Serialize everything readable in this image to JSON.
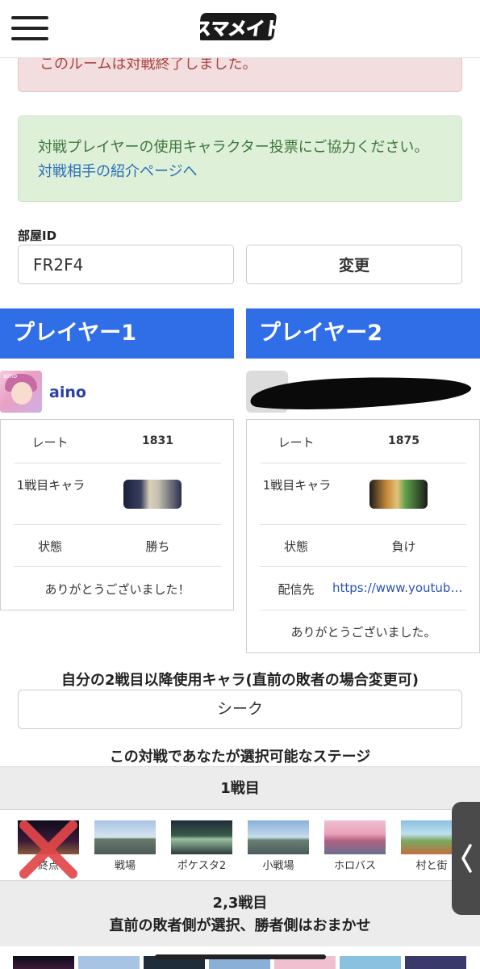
{
  "header": {
    "logo_text": "スマメイト"
  },
  "alert_closed": "このルームは対戦終了しました。",
  "vote_alert": {
    "text": "対戦プレイヤーの使用キャラクター投票にご協力ください。",
    "link": "対戦相手の紹介ページへ"
  },
  "room": {
    "label": "部屋ID",
    "value": "FR2F4",
    "change_label": "変更"
  },
  "player1": {
    "heading": "プレイヤー1",
    "name": "aino",
    "avatar_text": "aino",
    "rate_label": "レート",
    "rate": "1831",
    "char_label": "1戦目キャラ",
    "status_label": "状態",
    "status": "勝ち",
    "message": "ありがとうございました！"
  },
  "player2": {
    "heading": "プレイヤー2",
    "rate_label": "レート",
    "rate": "1875",
    "char_label": "1戦目キャラ",
    "status_label": "状態",
    "status": "負け",
    "stream_label": "配信先",
    "stream_url": "https://www.youtube…",
    "message": "ありがとうございました。"
  },
  "char_section": {
    "title": "自分の2戦目以降使用キャラ(直前の敗者の場合変更可)",
    "selected": "シーク"
  },
  "stage_section": {
    "title": "この対戦であなたが選択可能なステージ",
    "round1_label": "1戦目",
    "stages": [
      {
        "name": "終点",
        "disabled": true
      },
      {
        "name": "戦場",
        "disabled": false
      },
      {
        "name": "ポケスタ2",
        "disabled": false
      },
      {
        "name": "小戦場",
        "disabled": false
      },
      {
        "name": "ホロバス",
        "disabled": false
      },
      {
        "name": "村と街",
        "disabled": false
      }
    ],
    "round23_label": "2,3戦目",
    "round23_note": "直前の敗者側が選択、勝者側はおまかせ"
  },
  "icons": [
    "hamburger-icon",
    "chevron-left-icon",
    "x-mark-icon"
  ]
}
